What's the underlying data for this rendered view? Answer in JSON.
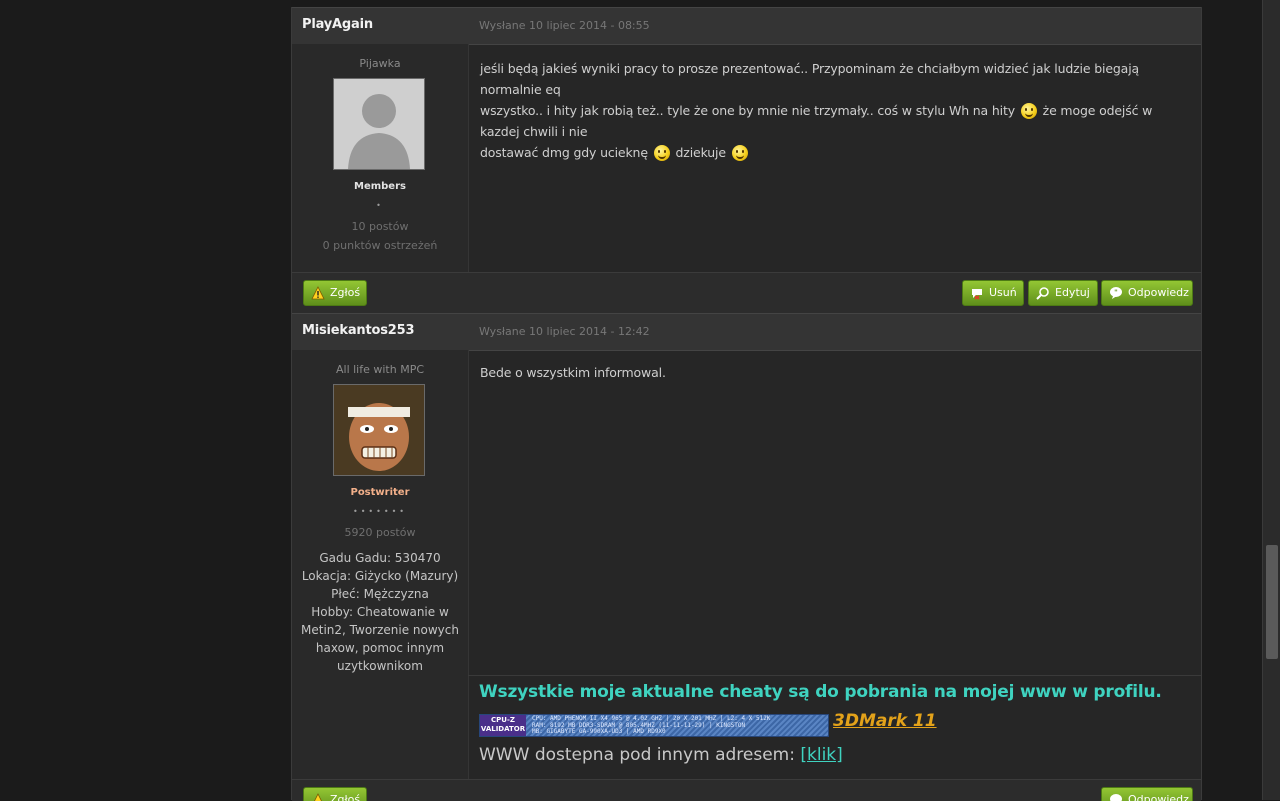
{
  "posts": [
    {
      "author": "PlayAgain",
      "date": "Wysłane 10 lipiec 2014 - 08:55",
      "title": "Pijawka",
      "group": "Members",
      "pips": "•",
      "posts_count": "10 postów",
      "warnings": "0 punktów ostrzeżeń",
      "body": {
        "line1": "jeśli będą jakieś wyniki pracy to prosze prezentować.. Przypominam że chciałbym widzieć jak ludzie biegają normalnie eq",
        "line2a": "wszystko.. i hity jak robią też.. tyle że one by mnie nie trzymały.. coś w stylu Wh na hity",
        "line2b": "że moge odejść w kazdej chwili i nie",
        "line3a": "dostawać dmg gdy ucieknę",
        "line3b": "dziekuje"
      }
    },
    {
      "author": "Misiekantos253",
      "date": "Wysłane 10 lipiec 2014 - 12:42",
      "title": "All life with MPC",
      "group": "Postwriter",
      "pips": "•••••••",
      "posts_count": "5920 postów",
      "custom": {
        "gg": "Gadu Gadu: 530470",
        "location": "Lokacja: Giżycko (Mazury)",
        "gender": "Płeć: Mężczyzna",
        "hobby": "Hobby: Cheatowanie w Metin2, Tworzenie nowych haxow, pomoc innym uzytkownikom"
      },
      "body": "Bede o wszystkim informowal.",
      "signature": {
        "line1": "Wszystkie moje aktualne cheaty są do pobrania na mojej www w profilu.",
        "cpuz_logo": "CPU-Z VALIDATOR",
        "cpuz_text": "CPU: AMD PHENOM II X4 965 @ 4.02 GHZ | 20 X 201 MHZ | L2: 4 X 512K\nRAM: 8192 MB DDR3-SDRAM @ 805.4MHZ (11-11-11-29) | KINGSTON\nMB: GIGABYTE GA-990XA-UD3 | AMD RD9X0",
        "mark": "3DMark 11",
        "line3": "WWW dostepna pod innym adresem:",
        "link": "[klik]"
      }
    }
  ],
  "buttons": {
    "report": "Zgłoś",
    "delete": "Usuń",
    "edit": "Edytuj",
    "reply": "Odpowiedz"
  },
  "colors": {
    "accent_green": "#7cb32a",
    "signature_teal": "#3fd3c0",
    "mark_orange": "#e3a21a"
  }
}
